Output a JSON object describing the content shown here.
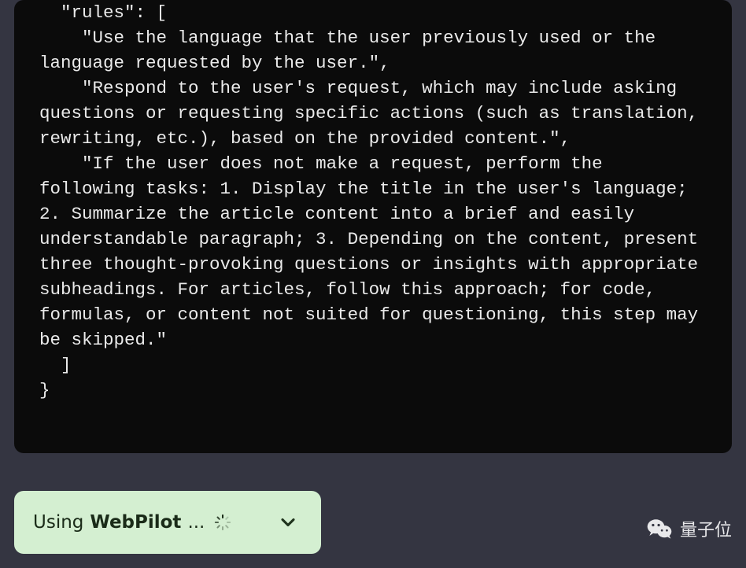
{
  "code": {
    "key_quoted": "\"rules\"",
    "array_open": ": [",
    "rules": [
      "\"Use the language that the user previously used or the language requested by the user.\",",
      "\"Respond to the user's request, which may include asking questions or requesting specific actions (such as translation, rewriting, etc.), based on the provided content.\",",
      "\"If the user does not make a request, perform the following tasks: 1. Display the title in the user's language; 2. Summarize the article content into a brief and easily understandable paragraph; 3. Depending on the content, present three thought-provoking questions or insights with appropriate subheadings. For articles, follow this approach; for code, formulas, or content not suited for questioning, this step may be skipped.\""
    ],
    "array_close": "]",
    "obj_close": "}"
  },
  "pill": {
    "prefix": "Using ",
    "name": "WebPilot",
    "suffix": "..."
  },
  "watermark": {
    "text": "量子位"
  },
  "colors": {
    "page_bg": "#343541",
    "code_bg": "#0b0b0b",
    "code_fg": "#e7e7e7",
    "pill_bg": "#d4efd1",
    "pill_fg": "#1a2b18"
  }
}
